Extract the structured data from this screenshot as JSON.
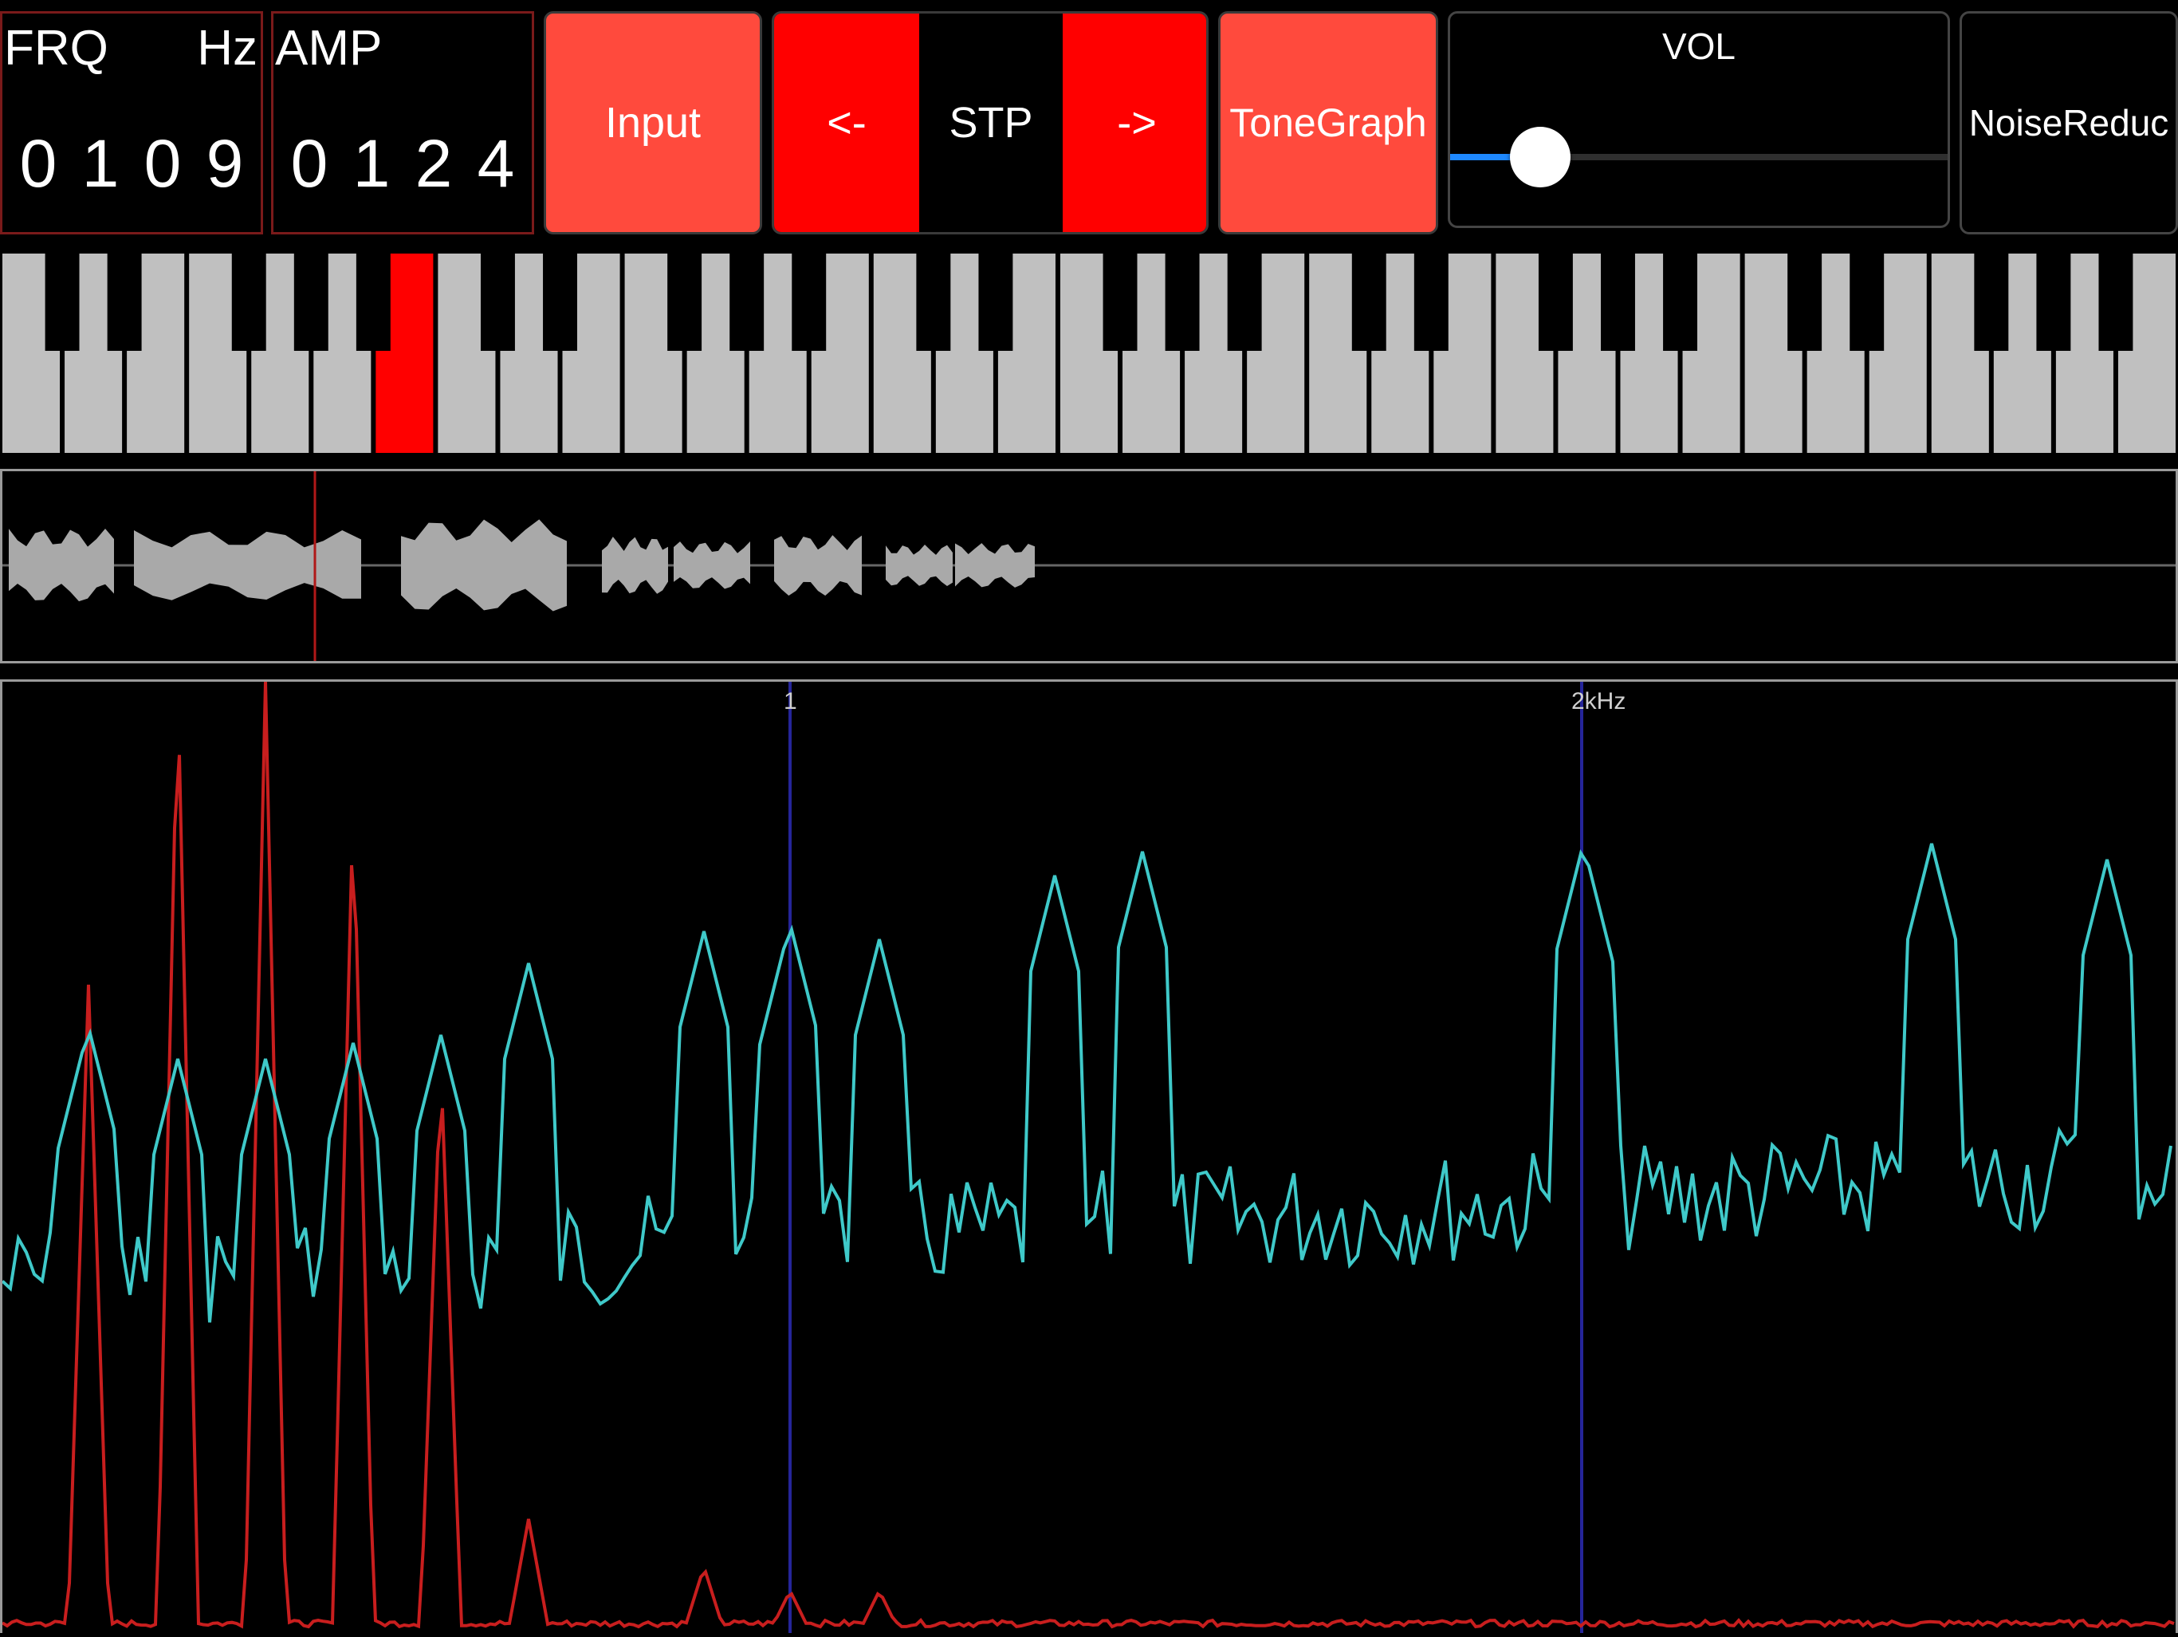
{
  "readouts": {
    "frq": {
      "label": "FRQ",
      "unit": "Hz",
      "digits": [
        "0",
        "1",
        "0",
        "9"
      ]
    },
    "amp": {
      "label": "AMP",
      "digits": [
        "0",
        "1",
        "2",
        "4"
      ]
    }
  },
  "buttons": {
    "input": "Input",
    "prev": "<-",
    "step": "STP",
    "next": "->",
    "tonegraph": "ToneGraph",
    "noise_reduc": "NoiseReduc"
  },
  "volume": {
    "label": "VOL",
    "value": 0.16
  },
  "keyboard": {
    "white_key_count": 35,
    "highlighted_white_key_index": 6
  },
  "spectrum": {
    "markers": [
      "1",
      "2kHz"
    ],
    "colors": {
      "spectrum": "#3fc9c9",
      "harmonics": "#c81e1e",
      "marker": "#2a2aa0"
    }
  },
  "colors": {
    "accent_red": "#ff4a3d",
    "bright_red": "#ff0000",
    "key_gray": "#c0c0c0",
    "wave_gray": "#a9a9a9"
  }
}
